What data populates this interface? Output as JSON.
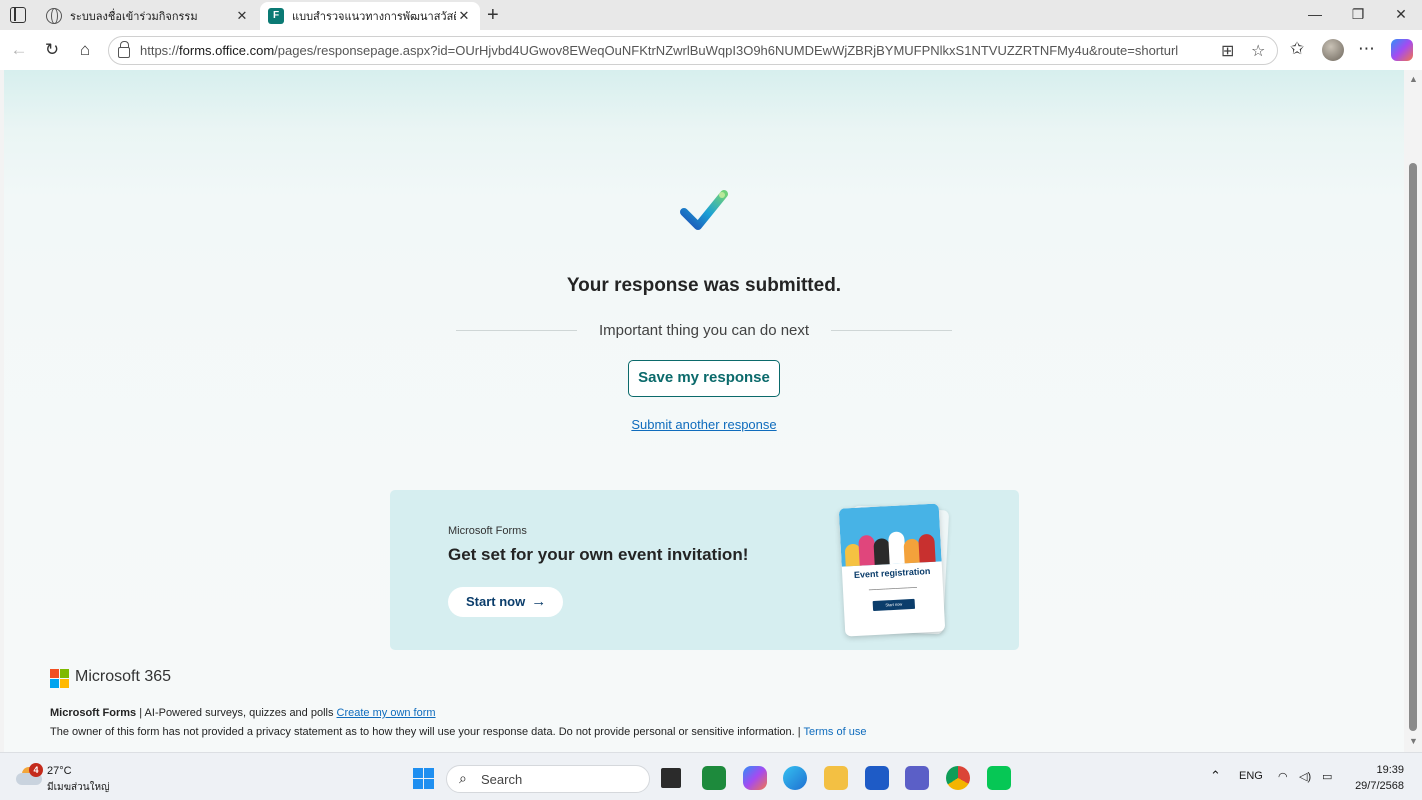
{
  "browser": {
    "tabs": [
      {
        "title": "ระบบลงชื่อเข้าร่วมกิจกรรม",
        "active": false
      },
      {
        "title": "แบบสำรวจแนวทางการพัฒนาสวัสดิการ",
        "active": true
      }
    ],
    "address": {
      "scheme": "https://",
      "host": "forms.office.com",
      "path": "/pages/responsepage.aspx?id=OUrHjvbd4UGwov8EWeqOuNFKtrNZwrlBuWqpI3O9h6NUMDEwWjZBRjBYMUFPNlkxS1NTVUZZRTNFMy4u&route=shorturl"
    }
  },
  "page": {
    "submitted_title": "Your response was submitted.",
    "next_label": "Important thing you can do next",
    "save_button": "Save my response",
    "another_link": "Submit another response",
    "promo": {
      "brand": "Microsoft Forms",
      "title": "Get set for your own event invitation!",
      "start_button": "Start now",
      "card_title": "Event registration",
      "card_button": "Start now"
    },
    "footer": {
      "logo_text": "Microsoft 365",
      "product": "Microsoft Forms",
      "tagline": " | AI-Powered surveys, quizzes and polls ",
      "create_link": "Create my own form",
      "privacy": "The owner of this form has not provided a privacy statement as to how they will use your response data. Do not provide personal or sensitive information. | ",
      "terms_link": "Terms of use"
    }
  },
  "taskbar": {
    "weather_badge": "4",
    "temperature": "27°C",
    "location": "มีเมฆส่วนใหญ่",
    "search_label": "Search",
    "language": "ENG",
    "time": "19:39",
    "date": "29/7/2568"
  },
  "colors": {
    "accent": "#0b6a6b",
    "link": "#0f6cbd",
    "promo_bg": "#d6eef0"
  }
}
